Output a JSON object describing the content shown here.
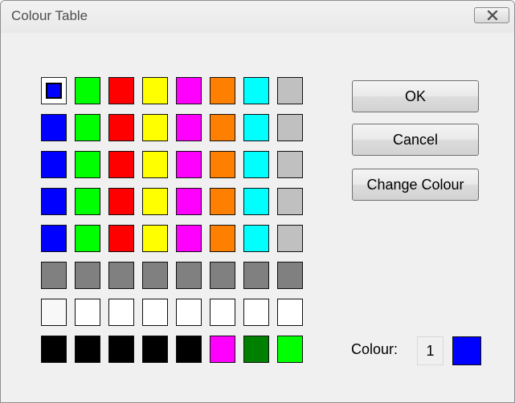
{
  "window": {
    "title": "Colour Table"
  },
  "palette": {
    "selected_index": 0,
    "rows": [
      [
        "#0000ff",
        "#00ff00",
        "#ff0000",
        "#ffff00",
        "#ff00ff",
        "#ff8000",
        "#00ffff",
        "#c0c0c0"
      ],
      [
        "#0000ff",
        "#00ff00",
        "#ff0000",
        "#ffff00",
        "#ff00ff",
        "#ff8000",
        "#00ffff",
        "#c0c0c0"
      ],
      [
        "#0000ff",
        "#00ff00",
        "#ff0000",
        "#ffff00",
        "#ff00ff",
        "#ff8000",
        "#00ffff",
        "#c0c0c0"
      ],
      [
        "#0000ff",
        "#00ff00",
        "#ff0000",
        "#ffff00",
        "#ff00ff",
        "#ff8000",
        "#00ffff",
        "#c0c0c0"
      ],
      [
        "#0000ff",
        "#00ff00",
        "#ff0000",
        "#ffff00",
        "#ff00ff",
        "#ff8000",
        "#00ffff",
        "#c0c0c0"
      ],
      [
        "#808080",
        "#808080",
        "#808080",
        "#808080",
        "#808080",
        "#808080",
        "#808080",
        "#808080"
      ],
      [
        "#f8f8f8",
        "#ffffff",
        "#ffffff",
        "#ffffff",
        "#ffffff",
        "#ffffff",
        "#ffffff",
        "#ffffff"
      ],
      [
        "#000000",
        "#000000",
        "#000000",
        "#000000",
        "#000000",
        "#ff00ff",
        "#008000",
        "#00ff00"
      ]
    ]
  },
  "buttons": {
    "ok": "OK",
    "cancel": "Cancel",
    "change_colour": "Change Colour"
  },
  "current": {
    "label": "Colour:",
    "index": "1",
    "color": "#0000ff"
  },
  "icons": {
    "close": "close-icon"
  }
}
